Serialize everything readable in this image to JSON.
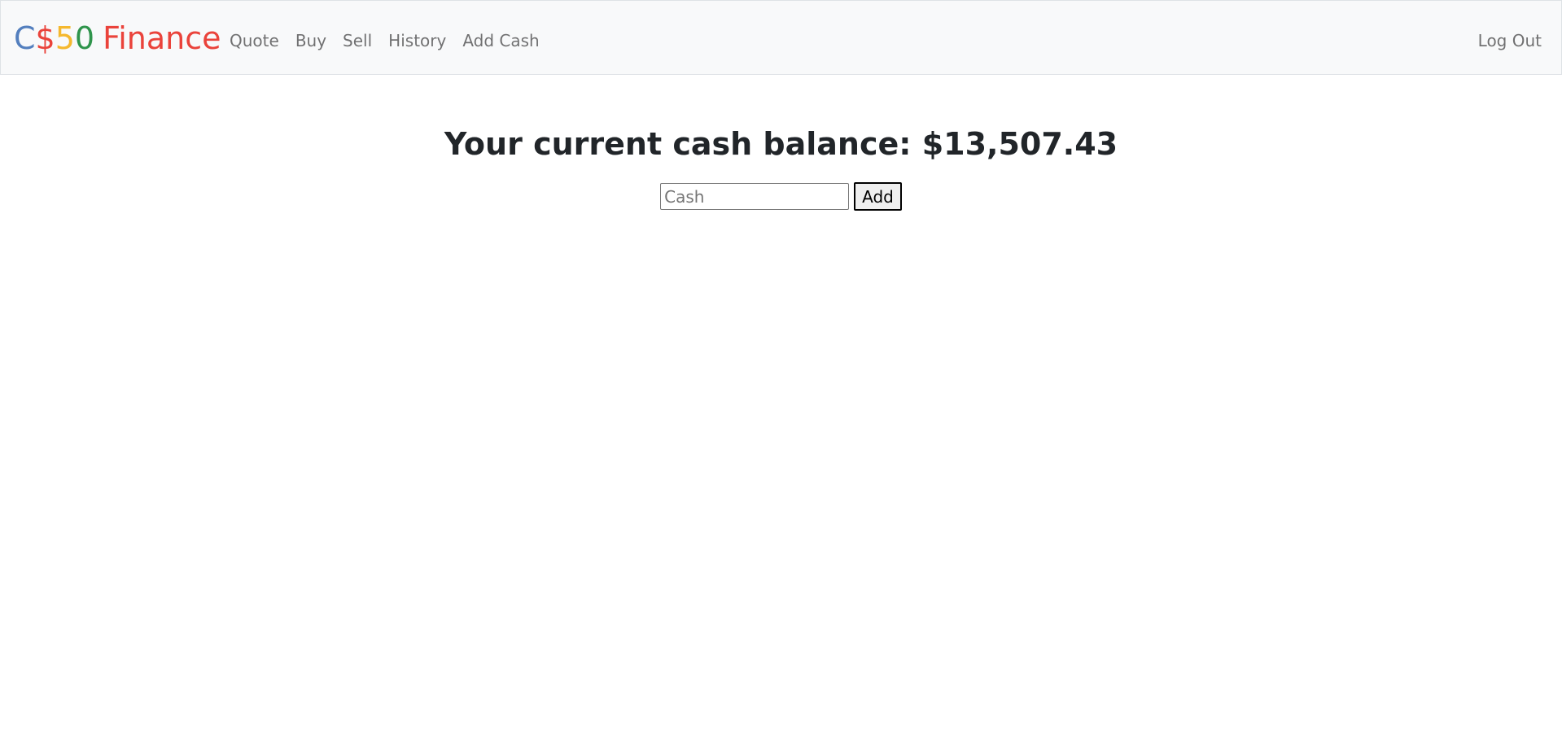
{
  "brand": {
    "parts": [
      {
        "text": "C",
        "color": "#537fbe"
      },
      {
        "text": "$",
        "color": "#ea433b"
      },
      {
        "text": "5",
        "color": "#f5b82e"
      },
      {
        "text": "0",
        "color": "#2e944b"
      },
      {
        "text": "Finance",
        "color": "#ea433b"
      }
    ]
  },
  "nav": {
    "items": [
      {
        "label": "Quote"
      },
      {
        "label": "Buy"
      },
      {
        "label": "Sell"
      },
      {
        "label": "History"
      },
      {
        "label": "Add Cash"
      }
    ],
    "logout_label": "Log Out"
  },
  "main": {
    "heading": "Your current cash balance: $13,507.43",
    "cash_input_placeholder": "Cash",
    "cash_input_value": "",
    "add_button_label": "Add"
  }
}
